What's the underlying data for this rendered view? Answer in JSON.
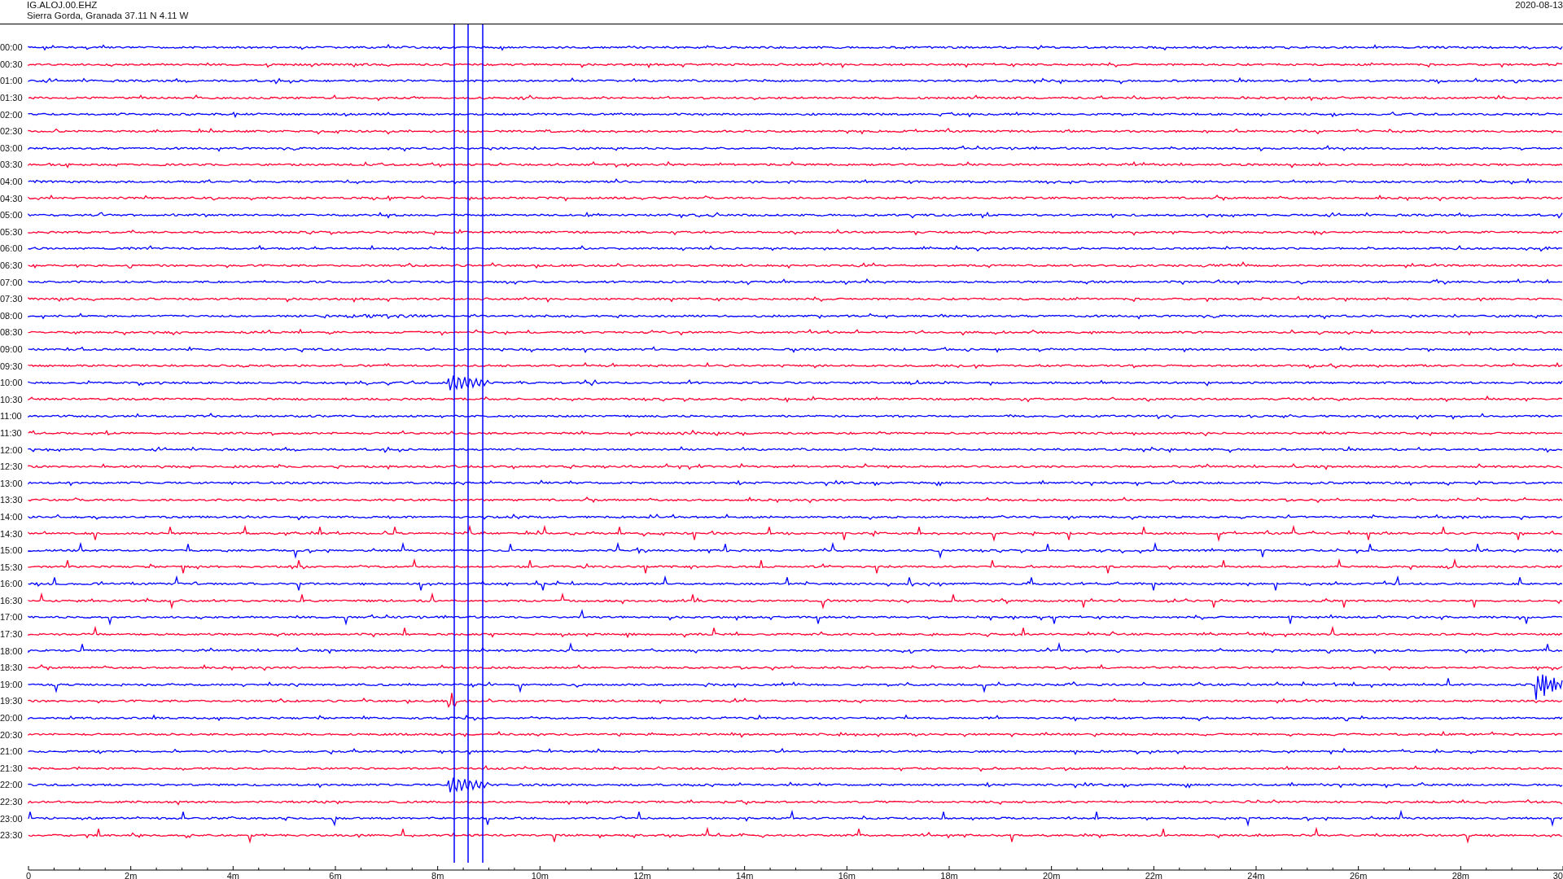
{
  "header": {
    "station": "IG.ALOJ.00.EHZ",
    "location": "Sierra Gorda, Granada  37.11 N 4.11 W",
    "date": "2020-08-13"
  },
  "rows": [
    {
      "time": "00:00",
      "color": "#0000ff"
    },
    {
      "time": "00:30",
      "color": "#ff0033"
    },
    {
      "time": "01:00",
      "color": "#0000ff"
    },
    {
      "time": "01:30",
      "color": "#ff0033"
    },
    {
      "time": "02:00",
      "color": "#0000ff"
    },
    {
      "time": "02:30",
      "color": "#ff0033"
    },
    {
      "time": "03:00",
      "color": "#0000ff"
    },
    {
      "time": "03:30",
      "color": "#ff0033"
    },
    {
      "time": "04:00",
      "color": "#0000ff"
    },
    {
      "time": "04:30",
      "color": "#ff0033"
    },
    {
      "time": "05:00",
      "color": "#0000ff"
    },
    {
      "time": "05:30",
      "color": "#ff0033"
    },
    {
      "time": "06:00",
      "color": "#0000ff"
    },
    {
      "time": "06:30",
      "color": "#ff0033"
    },
    {
      "time": "07:00",
      "color": "#0000ff"
    },
    {
      "time": "07:30",
      "color": "#ff0033"
    },
    {
      "time": "08:00",
      "color": "#0000ff"
    },
    {
      "time": "08:30",
      "color": "#ff0033"
    },
    {
      "time": "09:00",
      "color": "#0000ff"
    },
    {
      "time": "09:30",
      "color": "#ff0033"
    },
    {
      "time": "10:00",
      "color": "#0000ff"
    },
    {
      "time": "10:30",
      "color": "#ff0033"
    },
    {
      "time": "11:00",
      "color": "#0000ff"
    },
    {
      "time": "11:30",
      "color": "#ff0033"
    },
    {
      "time": "12:00",
      "color": "#0000ff"
    },
    {
      "time": "12:30",
      "color": "#ff0033"
    },
    {
      "time": "13:00",
      "color": "#0000ff"
    },
    {
      "time": "13:30",
      "color": "#ff0033"
    },
    {
      "time": "14:00",
      "color": "#0000ff"
    },
    {
      "time": "14:30",
      "color": "#ff0033"
    },
    {
      "time": "15:00",
      "color": "#0000ff"
    },
    {
      "time": "15:30",
      "color": "#ff0033"
    },
    {
      "time": "16:00",
      "color": "#0000ff"
    },
    {
      "time": "16:30",
      "color": "#ff0033"
    },
    {
      "time": "17:00",
      "color": "#0000ff"
    },
    {
      "time": "17:30",
      "color": "#ff0033"
    },
    {
      "time": "18:00",
      "color": "#0000ff"
    },
    {
      "time": "18:30",
      "color": "#ff0033"
    },
    {
      "time": "19:00",
      "color": "#0000ff"
    },
    {
      "time": "19:30",
      "color": "#ff0033"
    },
    {
      "time": "20:00",
      "color": "#0000ff"
    },
    {
      "time": "20:30",
      "color": "#ff0033"
    },
    {
      "time": "21:00",
      "color": "#0000ff"
    },
    {
      "time": "21:30",
      "color": "#ff0033"
    },
    {
      "time": "22:00",
      "color": "#0000ff"
    },
    {
      "time": "22:30",
      "color": "#ff0033"
    },
    {
      "time": "23:00",
      "color": "#0000ff"
    },
    {
      "time": "23:30",
      "color": "#ff0033"
    }
  ],
  "x_axis": {
    "ticks": [
      "0",
      "2m",
      "4m",
      "6m",
      "8m",
      "10m",
      "12m",
      "14m",
      "16m",
      "18m",
      "20m",
      "22m",
      "24m",
      "26m",
      "28m",
      "30"
    ]
  }
}
